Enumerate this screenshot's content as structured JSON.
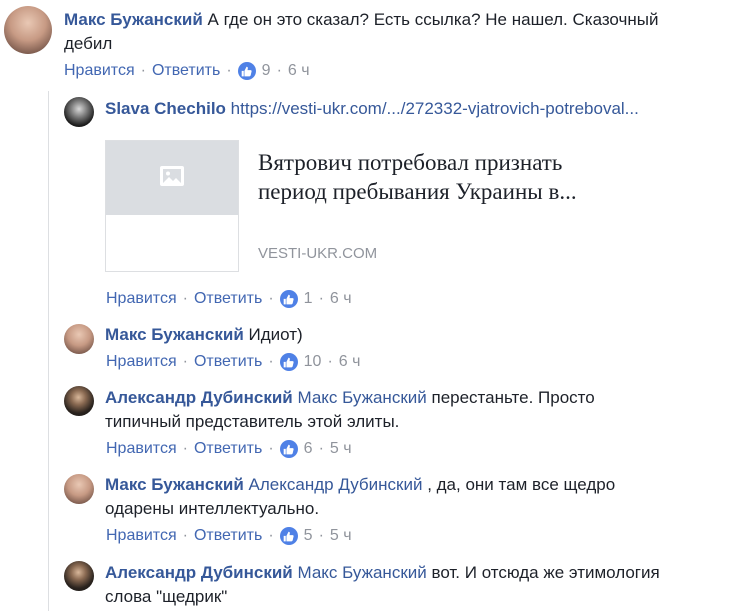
{
  "comments": [
    {
      "author": "Макс Бужанский",
      "text": "А где он это сказал? Есть ссылка? Не нашел. Сказочный",
      "text_line2": "дебил",
      "like_label": "Нравится",
      "reply_label": "Ответить",
      "likes": "9",
      "time": "6 ч"
    }
  ],
  "replies": [
    {
      "author": "Slava Chechilo",
      "link_text": "https://vesti-ukr.com/.../272332-vjatrovich-potreboval...",
      "preview_title": "Вятрович потребовал признать",
      "preview_title_line2": "период пребывания Украины в...",
      "preview_domain": "VESTI-UKR.COM",
      "like_label": "Нравится",
      "reply_label": "Ответить",
      "likes": "1",
      "time": "6 ч"
    },
    {
      "author": "Макс Бужанский",
      "text": "Идиот)",
      "like_label": "Нравится",
      "reply_label": "Ответить",
      "likes": "10",
      "time": "6 ч"
    },
    {
      "author": "Александр Дубинский",
      "mention": "Макс Бужанский",
      "text": "перестаньте. Просто",
      "text_line2": "типичный представитель этой элиты.",
      "like_label": "Нравится",
      "reply_label": "Ответить",
      "likes": "6",
      "time": "5 ч"
    },
    {
      "author": "Макс Бужанский",
      "mention": "Александр Дубинский",
      "text": ", да, они там все щедро",
      "text_line2": "одарены интеллектуально.",
      "like_label": "Нравится",
      "reply_label": "Ответить",
      "likes": "5",
      "time": "5 ч"
    },
    {
      "author": "Александр Дубинский",
      "mention": "Макс Бужанский",
      "text": "вот. И отсюда же этимология",
      "text_line2": "слова \"щедрик\""
    }
  ],
  "icons": {
    "like": "thumbs-up-icon",
    "image_placeholder": "image-icon"
  },
  "colors": {
    "link": "#365899",
    "action": "#4267b2",
    "meta": "#90949c",
    "like_badge": "#4f81e6"
  }
}
